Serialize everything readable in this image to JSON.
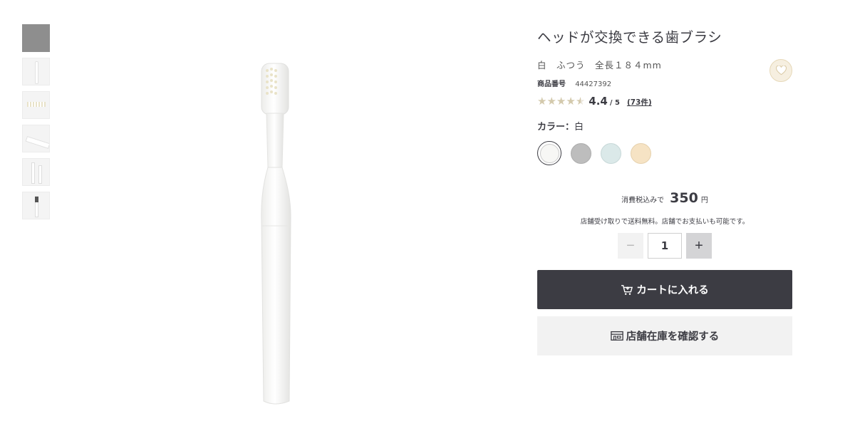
{
  "product": {
    "title": "ヘッドが交換できる歯ブラシ",
    "spec": "白　ふつう　全長１８４mm",
    "item_number_label": "商品番号",
    "item_number": "44427392",
    "rating": 4.4,
    "rating_text": "4.4",
    "rating_max": "/ 5",
    "reviews": "(73件)",
    "color_label": "カラー：",
    "color_value": "白",
    "colors": [
      {
        "name": "white",
        "hex": "#f7f7f5",
        "selected": true
      },
      {
        "name": "gray",
        "hex": "#bdbdbd"
      },
      {
        "name": "light-blue",
        "hex": "#dbe9e9"
      },
      {
        "name": "beige",
        "hex": "#f6e3c4"
      }
    ]
  },
  "price": {
    "prefix": "消費税込みで",
    "amount": "350",
    "unit": "円",
    "note": "店舗受け取りで送料無料。店舗でお支払いも可能です。"
  },
  "quantity": {
    "minus": "−",
    "value": "1",
    "plus": "+"
  },
  "buttons": {
    "cart": "カートに入れる",
    "stock": "店舗在庫を確認する"
  },
  "thumbnails": {
    "count": 6,
    "selected_index": 0
  },
  "icons": {
    "favorite": "heart-icon",
    "cart": "cart-icon",
    "store": "store-icon"
  }
}
